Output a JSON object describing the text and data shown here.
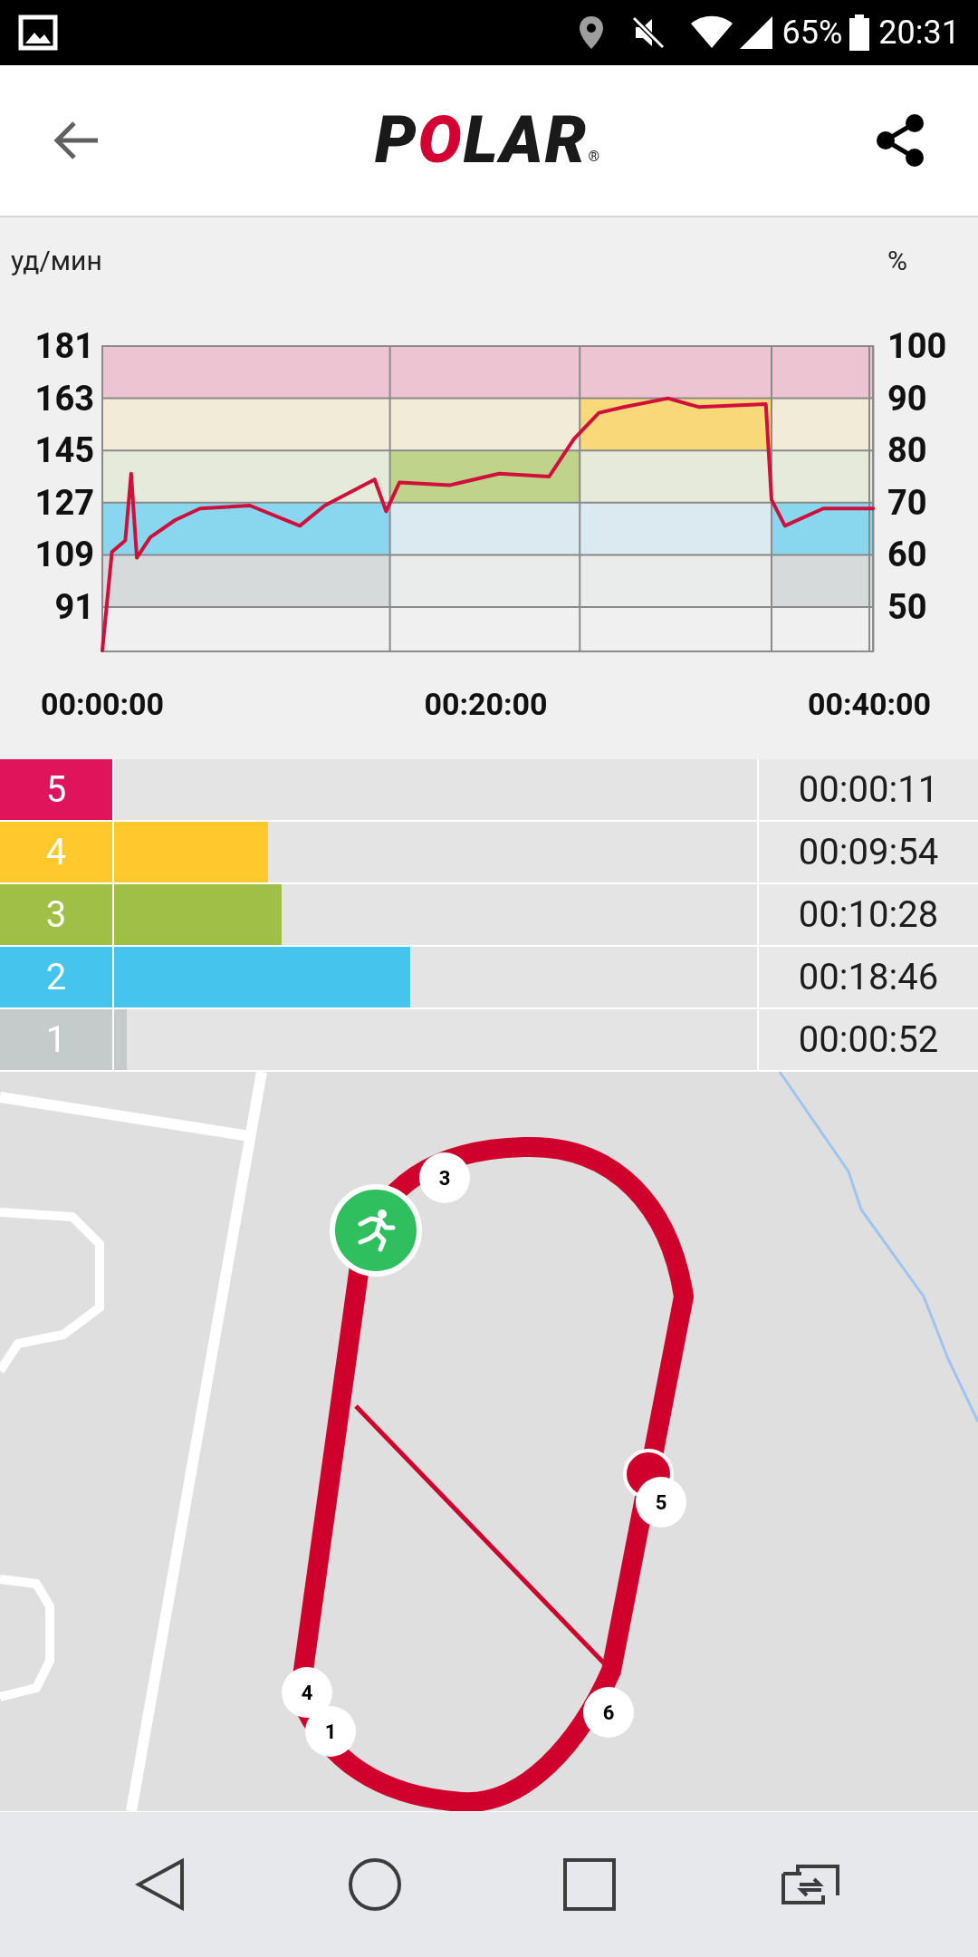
{
  "status_bar": {
    "battery": "65%",
    "time": "20:31"
  },
  "app_bar": {
    "logo": "POLAR",
    "logo_mark": "®"
  },
  "chart": {
    "right_unit": "%",
    "right_ticks": [
      "100",
      "90",
      "80",
      "70",
      "60",
      "50"
    ],
    "segments": [
      {
        "highlighted": [
          true,
          true,
          false,
          false,
          false
        ]
      },
      {
        "highlighted": [
          false,
          false,
          true,
          false,
          false
        ]
      },
      {
        "highlighted": [
          false,
          false,
          false,
          true,
          false
        ]
      },
      {
        "highlighted": [
          true,
          true,
          false,
          false,
          false
        ]
      }
    ],
    "chart_data": {
      "type": "line",
      "ylabel": "уд/мин",
      "x": [
        0,
        0.5,
        1.2,
        1.5,
        1.8,
        2.5,
        3.8,
        5.1,
        7.7,
        10.3,
        11.6,
        14.2,
        14.8,
        15.5,
        18.1,
        20.7,
        23.3,
        24.6,
        25.9,
        27.2,
        29.5,
        31.1,
        34.6,
        34.9,
        35.6,
        37.6,
        40.2
      ],
      "series": [
        {
          "color": "#d0103a",
          "values": [
            76,
            110,
            114,
            137,
            108,
            115,
            121,
            125,
            126,
            119,
            126,
            135,
            124,
            134,
            133,
            137,
            136,
            149,
            158,
            160,
            163,
            160,
            161,
            128,
            119,
            125,
            125
          ]
        }
      ],
      "xlim": [
        0,
        40.2
      ],
      "ylim": [
        75.7,
        181
      ],
      "xticks": [
        {
          "value": 0,
          "label": "00:00:00"
        },
        {
          "value": 20,
          "label": "00:20:00"
        },
        {
          "value": 40,
          "label": "00:40:00"
        }
      ],
      "yticks": [
        91,
        109,
        127,
        145,
        163,
        181
      ],
      "grid": true,
      "bands": [
        {
          "axis": "y",
          "from": 91,
          "to": 109,
          "color": "#c5cbcb"
        },
        {
          "axis": "y",
          "from": 109,
          "to": 127,
          "color": "#45c4ee"
        },
        {
          "axis": "y",
          "from": 127,
          "to": 145,
          "color": "#a0bf47"
        },
        {
          "axis": "y",
          "from": 145,
          "to": 163,
          "color": "#ffc82c"
        },
        {
          "axis": "y",
          "from": 163,
          "to": 181,
          "color": "#e0145a"
        },
        {
          "axis": "y",
          "from": 91,
          "to": 109,
          "color": "#c5cbcb"
        },
        {
          "axis": "y",
          "from": 109,
          "to": 127,
          "color": "#45c4ee"
        },
        {
          "axis": "y",
          "from": 127,
          "to": 145,
          "color": "#a0bf47"
        },
        {
          "axis": "y",
          "from": 145,
          "to": 163,
          "color": "#ffc82c"
        },
        {
          "axis": "y",
          "from": 163,
          "to": 181,
          "color": "#e0145a"
        },
        {
          "axis": "y",
          "from": 91,
          "to": 109,
          "color": "#c5cbcb"
        },
        {
          "axis": "y",
          "from": 109,
          "to": 127,
          "color": "#45c4ee"
        },
        {
          "axis": "y",
          "from": 127,
          "to": 145,
          "color": "#a0bf47"
        },
        {
          "axis": "y",
          "from": 145,
          "to": 163,
          "color": "#ffc82c"
        },
        {
          "axis": "y",
          "from": 163,
          "to": 181,
          "color": "#e0145a"
        },
        {
          "axis": "y",
          "from": 91,
          "to": 109,
          "color": "#c5cbcb"
        },
        {
          "axis": "y",
          "from": 109,
          "to": 127,
          "color": "#45c4ee"
        },
        {
          "axis": "y",
          "from": 127,
          "to": 145,
          "color": "#a0bf47"
        },
        {
          "axis": "y",
          "from": 145,
          "to": 163,
          "color": "#ffc82c"
        },
        {
          "axis": "y",
          "from": 163,
          "to": 181,
          "color": "#e0145a"
        }
      ]
    }
  },
  "zones": [
    {
      "number": "5",
      "color": "#e0145a",
      "level": 0,
      "time": "00:00:11"
    },
    {
      "number": "4",
      "color": "#ffc82c",
      "level": 0.24,
      "time": "00:09:54"
    },
    {
      "number": "3",
      "color": "#a0bf47",
      "level": 0.26,
      "time": "00:10:28"
    },
    {
      "number": "2",
      "color": "#45c4ee",
      "level": 0.46,
      "time": "00:18:46"
    },
    {
      "number": "1",
      "color": "#c5cbcb",
      "level": 0.02,
      "time": "00:00:52"
    }
  ],
  "map": {
    "kind": "picture",
    "markers": [
      {
        "label": "3"
      },
      {
        "label": "5"
      },
      {
        "label": "4"
      },
      {
        "label": "1"
      },
      {
        "label": "6"
      }
    ]
  }
}
